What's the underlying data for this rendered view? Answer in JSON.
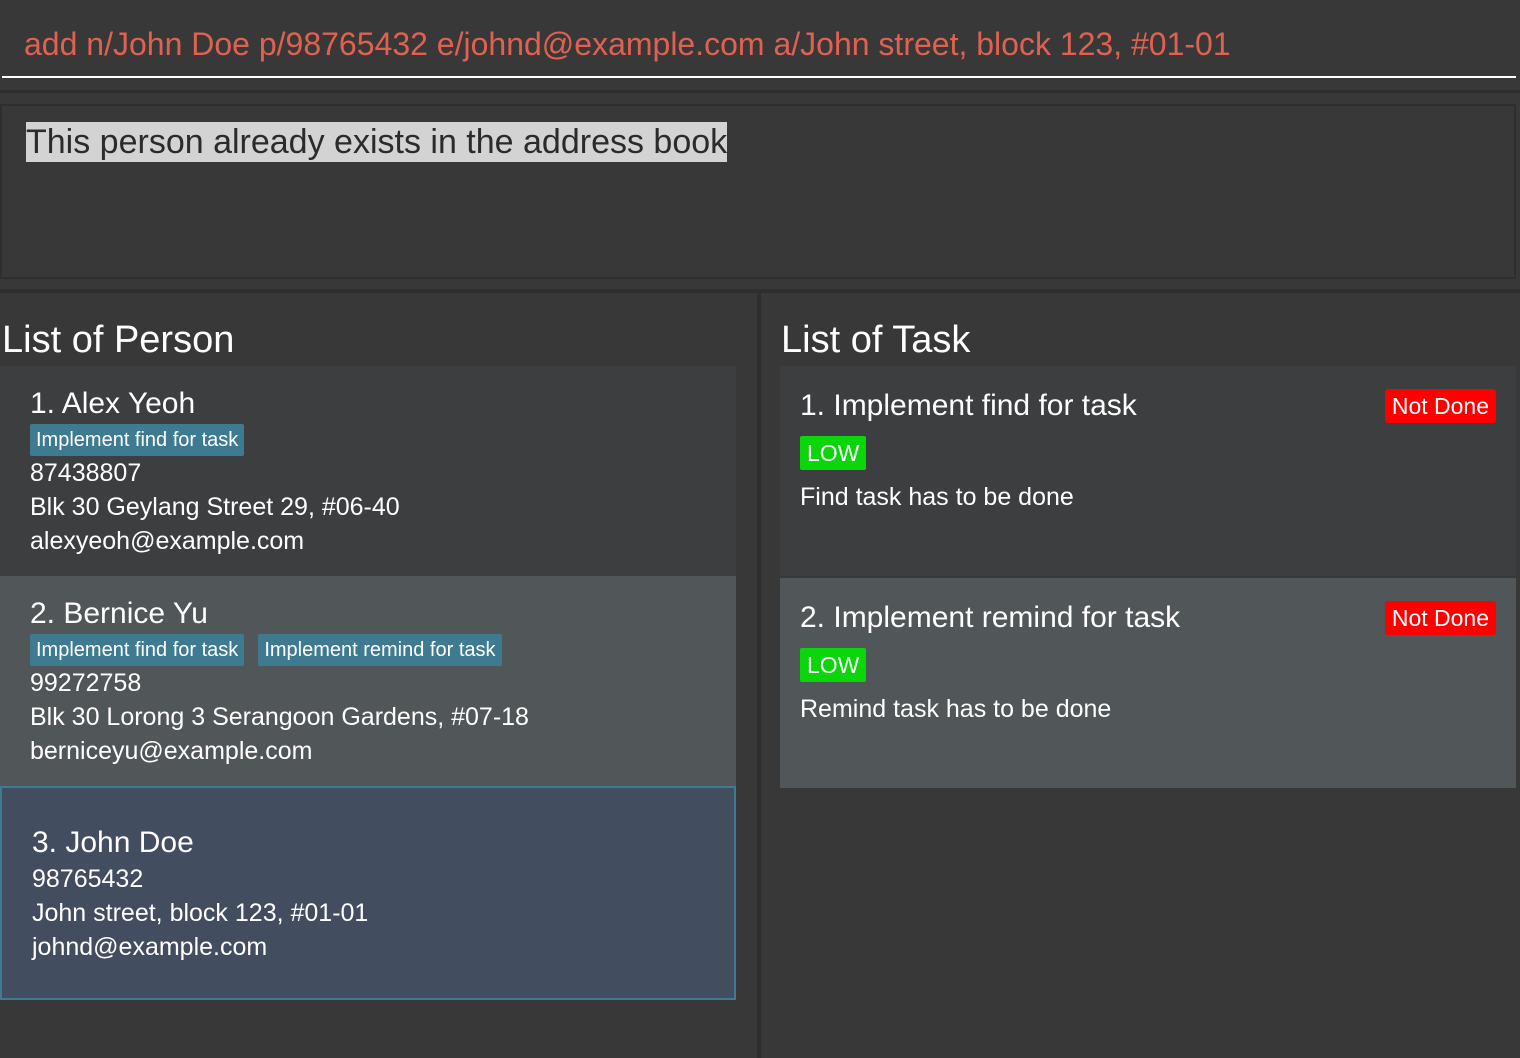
{
  "command": {
    "value": "add n/John Doe p/98765432 e/johnd@example.com a/John street, block 123, #01-01"
  },
  "result": {
    "message": "This person already exists in the address book"
  },
  "person_panel": {
    "title": "List of Person",
    "persons": [
      {
        "name": "1.  Alex Yeoh",
        "tags": [
          "Implement find for task"
        ],
        "phone": "87438807",
        "address": "Blk 30 Geylang Street 29, #06-40",
        "email": "alexyeoh@example.com"
      },
      {
        "name": "2.  Bernice Yu",
        "tags": [
          "Implement find for task",
          "Implement remind for task"
        ],
        "phone": "99272758",
        "address": "Blk 30 Lorong 3 Serangoon Gardens, #07-18",
        "email": "berniceyu@example.com"
      },
      {
        "name": "3.  John Doe",
        "tags": [],
        "phone": "98765432",
        "address": "John street, block 123, #01-01",
        "email": "johnd@example.com"
      }
    ]
  },
  "task_panel": {
    "title": "List of Task",
    "tasks": [
      {
        "title": "1. Implement find for task",
        "status": "Not Done",
        "priority": "LOW",
        "description": "Find task has to be done"
      },
      {
        "title": "2. Implement remind for task",
        "status": "Not Done",
        "priority": "LOW",
        "description": "Remind task has to be done"
      }
    ]
  },
  "colors": {
    "command_text": "#e06150",
    "tag_bg": "#3e7b91",
    "status_not_done": "#ff0000",
    "priority_low": "#0ad60a",
    "selected_card_bg": "#424d5f"
  }
}
